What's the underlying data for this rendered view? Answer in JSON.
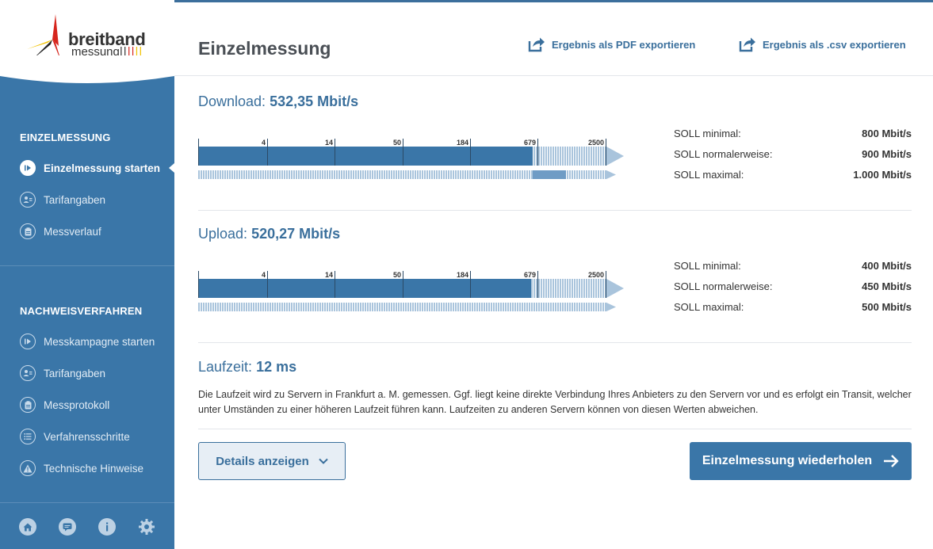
{
  "brand": {
    "line1": "breitband",
    "line2": "messung"
  },
  "sidebar": {
    "section1": "EINZELMESSUNG",
    "items1": [
      {
        "label": "Einzelmessung starten",
        "icon": "play-circle-icon",
        "active": true
      },
      {
        "label": "Tarifangaben",
        "icon": "user-card-icon"
      },
      {
        "label": "Messverlauf",
        "icon": "clipboard-icon"
      }
    ],
    "section2": "NACHWEISVERFAHREN",
    "items2": [
      {
        "label": "Messkampagne starten",
        "icon": "play-circle-icon"
      },
      {
        "label": "Tarifangaben",
        "icon": "user-card-icon"
      },
      {
        "label": "Messprotokoll",
        "icon": "clipboard-icon"
      },
      {
        "label": "Verfahrensschritte",
        "icon": "list-icon"
      },
      {
        "label": "Technische Hinweise",
        "icon": "warning-icon"
      }
    ],
    "bottom_icons": [
      "home-icon",
      "chat-icon",
      "info-icon",
      "gear-icon"
    ]
  },
  "header": {
    "title": "Einzelmessung",
    "export_pdf": "Ergebnis als PDF exportieren",
    "export_csv": "Ergebnis als .csv exportieren"
  },
  "download": {
    "label": "Download:",
    "value": "532,35 Mbit/s",
    "ticks": [
      "4",
      "14",
      "50",
      "184",
      "679",
      "2500"
    ],
    "fill_fraction": 0.82,
    "secondary_fraction": 0.9,
    "soll": [
      {
        "label": "SOLL minimal:",
        "value": "800 Mbit/s"
      },
      {
        "label": "SOLL normalerweise:",
        "value": "900 Mbit/s"
      },
      {
        "label": "SOLL maximal:",
        "value": "1.000 Mbit/s"
      }
    ]
  },
  "upload": {
    "label": "Upload:",
    "value": "520,27 Mbit/s",
    "ticks": [
      "4",
      "14",
      "50",
      "184",
      "679",
      "2500"
    ],
    "fill_fraction": 0.815,
    "secondary_fraction": 0.815,
    "soll": [
      {
        "label": "SOLL minimal:",
        "value": "400 Mbit/s"
      },
      {
        "label": "SOLL normalerweise:",
        "value": "450 Mbit/s"
      },
      {
        "label": "SOLL maximal:",
        "value": "500 Mbit/s"
      }
    ]
  },
  "latency": {
    "label": "Laufzeit:",
    "value": "12 ms",
    "description": "Die Laufzeit wird zu Servern in Frankfurt a. M. gemessen. Ggf. liegt keine direkte Verbindung Ihres Anbieters zu den Servern vor und es erfolgt ein Transit, welcher unter Umständen zu einer höheren Laufzeit führen kann. Laufzeiten zu anderen Servern können von diesen Werten abweichen."
  },
  "actions": {
    "details": "Details anzeigen",
    "repeat": "Einzelmessung wiederholen"
  },
  "colors": {
    "sidebar": "#3a76a8",
    "accent": "#3a6f9c",
    "bar": "#3a76a8",
    "bar_light": "#a9c4dc"
  }
}
